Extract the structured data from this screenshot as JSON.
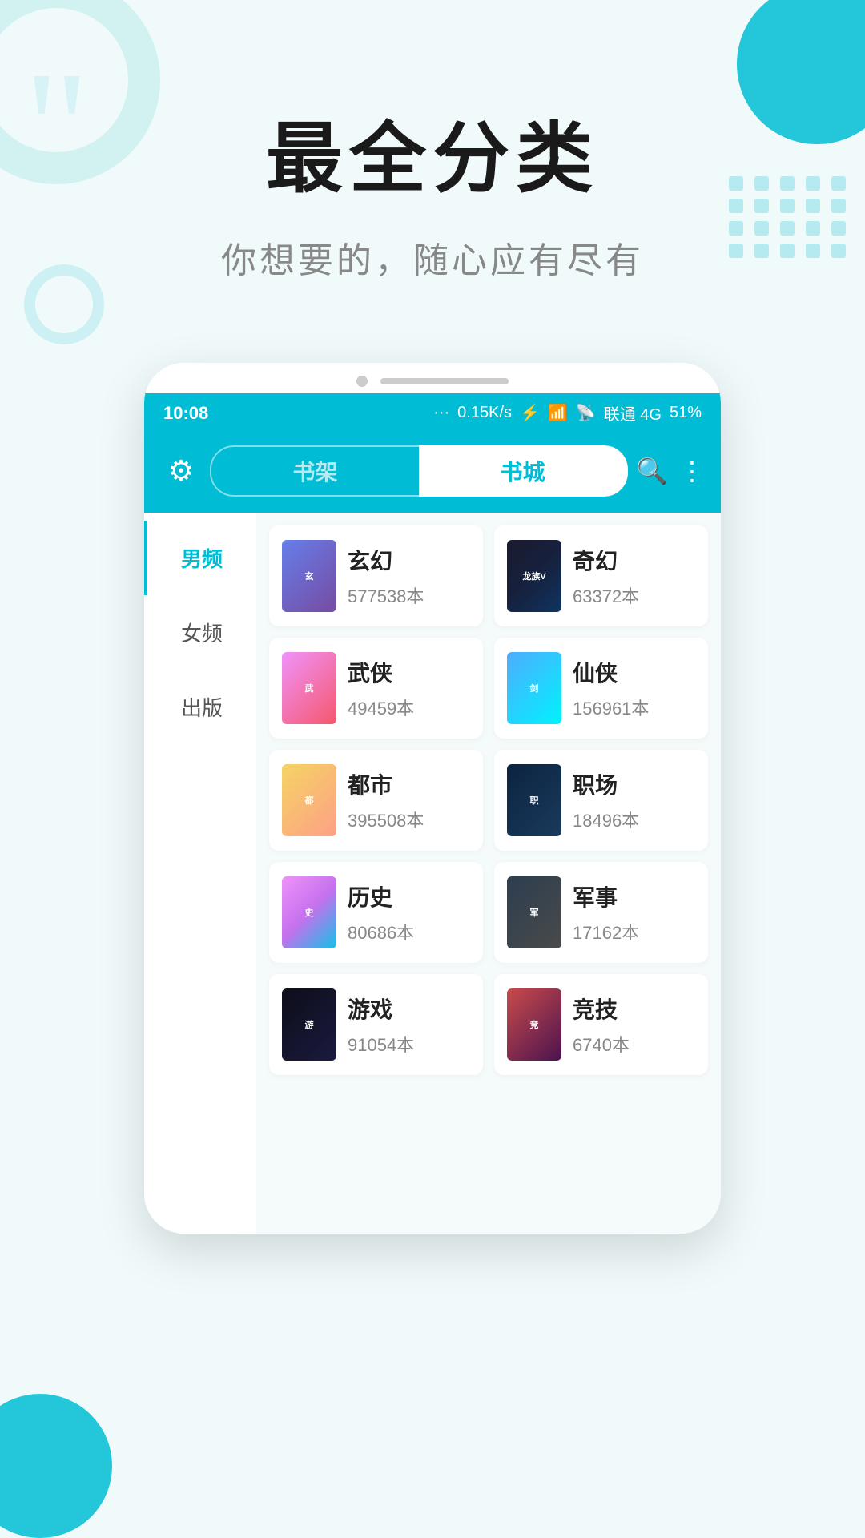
{
  "hero": {
    "title": "最全分类",
    "subtitle": "你想要的，随心应有尽有"
  },
  "status_bar": {
    "time": "10:08",
    "network": "0.15K/s",
    "carrier": "联通 4G",
    "battery": "51%"
  },
  "nav": {
    "tab_shelf": "书架",
    "tab_store": "书城",
    "active_tab": "store"
  },
  "sidebar": {
    "items": [
      {
        "id": "male",
        "label": "男频",
        "active": true
      },
      {
        "id": "female",
        "label": "女频",
        "active": false
      },
      {
        "id": "publish",
        "label": "出版",
        "active": false
      }
    ]
  },
  "categories": [
    {
      "id": "xuanhuan",
      "name": "玄幻",
      "count": "577538本",
      "cover_class": "cover-xuanhuan",
      "cover_text": "玄"
    },
    {
      "id": "qihuan",
      "name": "奇幻",
      "count": "63372本",
      "cover_class": "cover-qihuan",
      "cover_text": "龙族V"
    },
    {
      "id": "wuxia",
      "name": "武侠",
      "count": "49459本",
      "cover_class": "cover-wuxia",
      "cover_text": "武"
    },
    {
      "id": "xianxia",
      "name": "仙侠",
      "count": "156961本",
      "cover_class": "cover-xianxia",
      "cover_text": "剑"
    },
    {
      "id": "dushi",
      "name": "都市",
      "count": "395508本",
      "cover_class": "cover-dushi",
      "cover_text": "都"
    },
    {
      "id": "zhichang",
      "name": "职场",
      "count": "18496本",
      "cover_class": "cover-zhichang",
      "cover_text": "职"
    },
    {
      "id": "lishi",
      "name": "历史",
      "count": "80686本",
      "cover_class": "cover-lishi",
      "cover_text": "史"
    },
    {
      "id": "junshi",
      "name": "军事",
      "count": "17162本",
      "cover_class": "cover-junshi",
      "cover_text": "军"
    },
    {
      "id": "youxi",
      "name": "游戏",
      "count": "91054本",
      "cover_class": "cover-youxi",
      "cover_text": "游"
    },
    {
      "id": "jingji",
      "name": "竞技",
      "count": "6740本",
      "cover_class": "cover-jingji",
      "cover_text": "竞"
    }
  ]
}
